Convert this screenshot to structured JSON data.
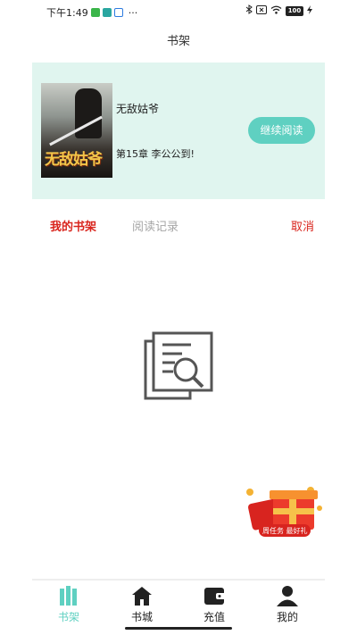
{
  "status_bar": {
    "time": "下午1:49",
    "battery": "100",
    "more": "···"
  },
  "header": {
    "title": "书架"
  },
  "recent": {
    "cover_title": "无敌姑爷",
    "book_title": "无敌姑爷",
    "chapter": "第15章 李公公到!",
    "continue_label": "继续阅读"
  },
  "tabs": {
    "mine": "我的书架",
    "history": "阅读记录",
    "cancel": "取消"
  },
  "promo": {
    "label": "周任务 最好礼"
  },
  "bottom_nav": [
    {
      "label": "书架",
      "icon": "books-icon",
      "active": true
    },
    {
      "label": "书城",
      "icon": "home-icon",
      "active": false
    },
    {
      "label": "充值",
      "icon": "wallet-icon",
      "active": false
    },
    {
      "label": "我的",
      "icon": "person-icon",
      "active": false
    }
  ],
  "colors": {
    "accent": "#5fd0c1",
    "active_tab": "#d9251d",
    "card_bg": "#e0f5ef",
    "nav_active": "#5fd0c1",
    "nav_inactive": "#222222"
  }
}
